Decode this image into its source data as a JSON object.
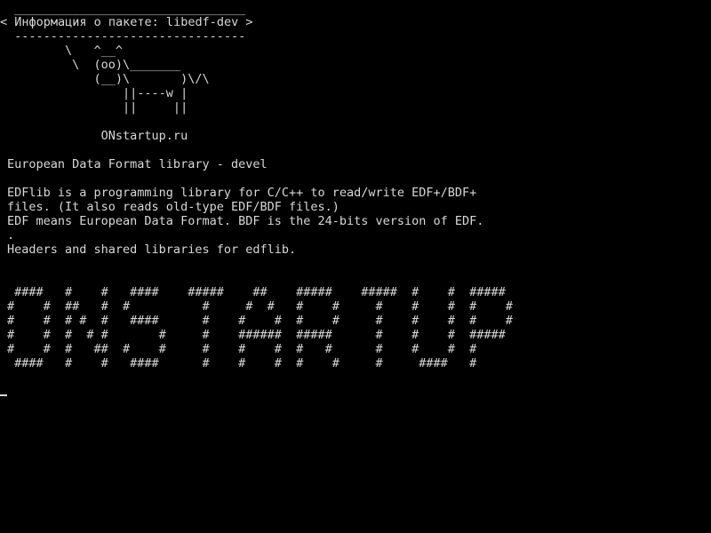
{
  "terminal": {
    "balloon": {
      "top_border": " ________________________________",
      "text": "< Информация о пакете: libedf-dev >",
      "bottom_border": " --------------------------------"
    },
    "cow": [
      "        \\   ^__^",
      "         \\  (oo)\\_______",
      "            (__)\\       )\\/\\",
      "                ||----w |",
      "                ||     ||"
    ],
    "site": "             ONstartup.ru",
    "summary": "European Data Format library - devel",
    "description": [
      "EDFlib is a programming library for C/C++ to read/write EDF+/BDF+",
      "files. (It also reads old-type EDF/BDF files.)",
      "EDF means European Data Format. BDF is the 24-bits version of EDF.",
      ".",
      "Headers and shared libraries for edflib."
    ],
    "banner": [
      " ####   #    #   ####    #####    ##    #####    #####  #    #  #####",
      "#    #  ##   #  #          #     #  #   #    #     #    #    #  #    #",
      "#    #  # #  #   ####      #    #    #  #    #     #    #    #  #    #",
      "#    #  #  # #       #     #    ######  #####      #    #    #  #####",
      "#    #  #   ##  #    #     #    #    #  #   #      #    #    #  #",
      " ####   #    #   ####      #    #    #  #    #     #     ####   #"
    ],
    "colors": {
      "background": "#000000",
      "foreground": "#d8d8d8"
    }
  }
}
